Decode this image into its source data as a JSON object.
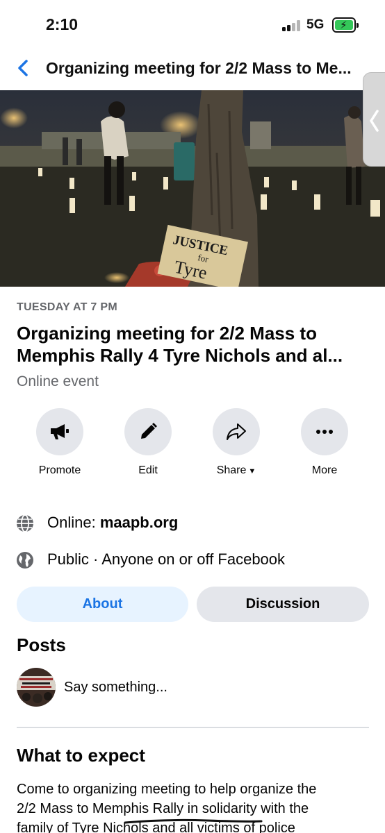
{
  "status_bar": {
    "time": "2:10",
    "network": "5G"
  },
  "nav": {
    "title": "Organizing meeting for 2/2 Mass to Me..."
  },
  "cover": {
    "sign_line1": "JUSTICE",
    "sign_line2": "for",
    "sign_line3": "Tyre"
  },
  "event": {
    "date": "TUESDAY AT 7 PM",
    "title_line1": "Organizing meeting for 2/2 Mass to",
    "title_line2": "Memphis Rally 4 Tyre Nichols and al...",
    "location": "Online event"
  },
  "actions": {
    "promote": "Promote",
    "edit": "Edit",
    "share": "Share",
    "more": "More"
  },
  "details": {
    "online_prefix": "Online: ",
    "online_link": "maapb.org",
    "privacy": "Public · Anyone on or off Facebook"
  },
  "tabs": {
    "about": "About",
    "discussion": "Discussion"
  },
  "posts": {
    "heading": "Posts",
    "composer_placeholder": "Say something..."
  },
  "expect": {
    "heading": "What to expect",
    "line1": "Come to organizing meeting to help organize the",
    "line2": "2/2 Mass to Memphis Rally in solidarity with the",
    "line3": "family of Tyre Nichols and all victims of police"
  },
  "colors": {
    "accent": "#1b74e4",
    "tab_active_bg": "#e7f3ff",
    "button_bg": "#e4e6eb",
    "secondary_text": "#65676b"
  }
}
